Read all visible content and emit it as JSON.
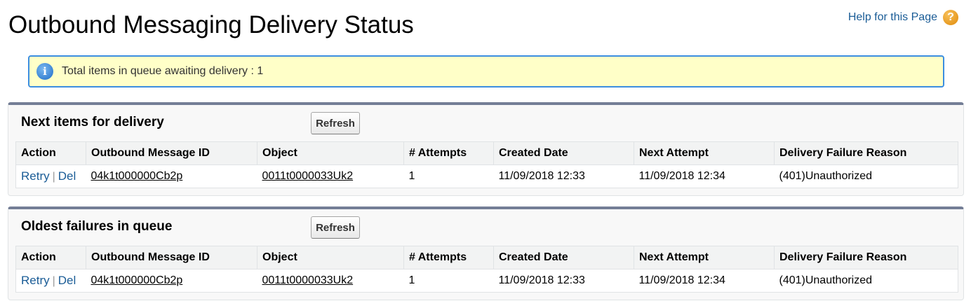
{
  "page": {
    "title": "Outbound Messaging Delivery Status",
    "help_label": "Help for this Page",
    "help_icon": "help-question-icon"
  },
  "info": {
    "icon": "info-icon",
    "text": "Total items in queue awaiting delivery : 1"
  },
  "columns": [
    "Action",
    "Outbound Message ID",
    "Object",
    "# Attempts",
    "Created Date",
    "Next Attempt",
    "Delivery Failure Reason"
  ],
  "sections": [
    {
      "title": "Next items for delivery",
      "refresh_label": "Refresh",
      "rows": [
        {
          "retry": "Retry",
          "separator": "|",
          "del": "Del",
          "message_id": "04k1t000000Cb2p",
          "object": "0011t0000033Uk2",
          "attempts": "1",
          "created": "11/09/2018 12:33",
          "next_attempt": "11/09/2018 12:34",
          "failure_reason": "(401)Unauthorized"
        }
      ]
    },
    {
      "title": "Oldest failures in queue",
      "refresh_label": "Refresh",
      "rows": [
        {
          "retry": "Retry",
          "separator": "|",
          "del": "Del",
          "message_id": "04k1t000000Cb2p",
          "object": "0011t0000033Uk2",
          "attempts": "1",
          "created": "11/09/2018 12:33",
          "next_attempt": "11/09/2018 12:34",
          "failure_reason": "(401)Unauthorized"
        }
      ]
    }
  ],
  "colors": {
    "info_bg": "#ffffc8",
    "info_border": "#3c8ee0",
    "panel_accent": "#747e96",
    "link": "#1a5c96"
  }
}
